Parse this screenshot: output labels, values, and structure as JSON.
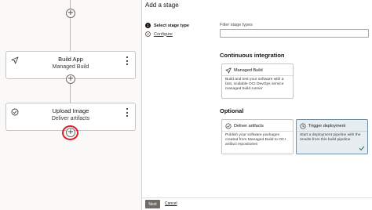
{
  "pipeline": {
    "stages": [
      {
        "title": "Build App",
        "subtitle": "Managed Build",
        "icon": "send-icon"
      },
      {
        "title": "Upload Image",
        "subtitle": "Deliver artifacts",
        "icon": "check-circle-icon"
      }
    ],
    "highlight_color": "#d9202a"
  },
  "panel": {
    "title": "Add a stage",
    "steps": [
      {
        "number": "1",
        "label": "Select stage type",
        "state": "active"
      },
      {
        "number": "2",
        "label": "Configure",
        "state": "inactive"
      }
    ],
    "filter": {
      "label": "Filter stage types",
      "value": "",
      "placeholder": ""
    },
    "sections": [
      {
        "title": "Continuous integration",
        "cards": [
          {
            "title": "Managed Build",
            "icon": "send-icon",
            "description": "Build and test your software with a fast, scalable OCI DevOps service managed build runner",
            "selected": false
          }
        ]
      },
      {
        "title": "Optional",
        "cards": [
          {
            "title": "Deliver artifacts",
            "icon": "check-circle-icon",
            "description": "Publish your software packages created from Managed Build to OCI artifact repositories",
            "selected": false
          },
          {
            "title": "Trigger deployment",
            "icon": "clock-icon",
            "description": "Start a deployment pipeline with the results from this build pipeline",
            "selected": true
          }
        ]
      }
    ],
    "footer": {
      "next_label": "Next",
      "cancel_label": "Cancel"
    }
  }
}
